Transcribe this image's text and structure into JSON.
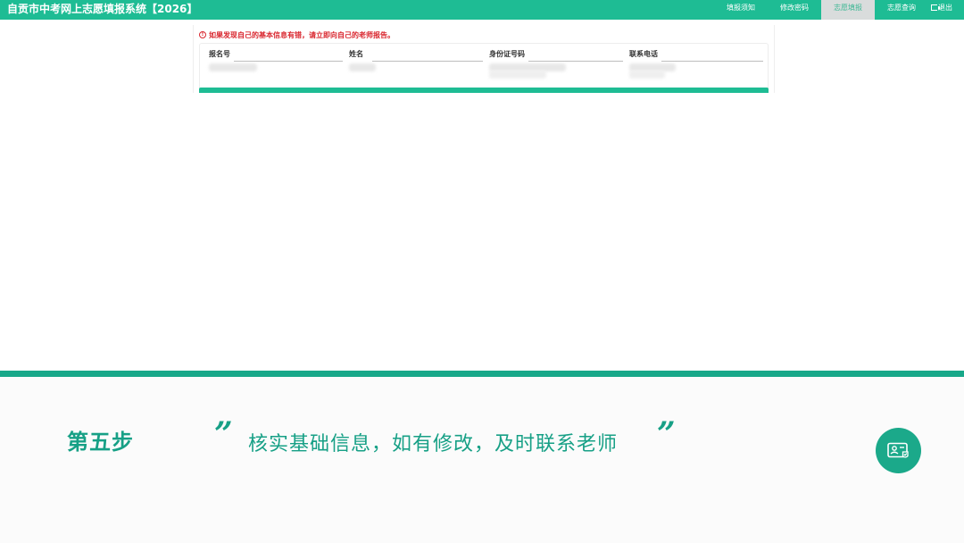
{
  "app": {
    "title": "自贡市中考网上志愿填报系统【2026】"
  },
  "nav": {
    "items": [
      {
        "label": "填报须知",
        "active": false
      },
      {
        "label": "修改密码",
        "active": false
      },
      {
        "label": "志愿填报",
        "active": true
      },
      {
        "label": "志愿查询",
        "active": false
      },
      {
        "label": "退出",
        "icon": "logout-icon",
        "active": false
      }
    ]
  },
  "notice": {
    "icon": "warning-circle-icon",
    "text": "如果发现自己的基本信息有错，请立即向自己的老师报告。"
  },
  "fields": [
    {
      "label": "报名号",
      "value": ""
    },
    {
      "label": "姓名",
      "value": ""
    },
    {
      "label": "身份证号码",
      "value": ""
    },
    {
      "label": "联系电话",
      "value": ""
    }
  ],
  "caption": {
    "step": "第五步",
    "open_quote": "”",
    "text": "核实基础信息，如有修改，及时联系老师",
    "close_quote": "”"
  },
  "fab": {
    "icon": "id-card-verified-icon"
  },
  "colors": {
    "brand": "#1ebc94",
    "caption_accent": "#17a086",
    "notice": "#d9262e",
    "active_tab_bg": "#d9dcdc"
  }
}
